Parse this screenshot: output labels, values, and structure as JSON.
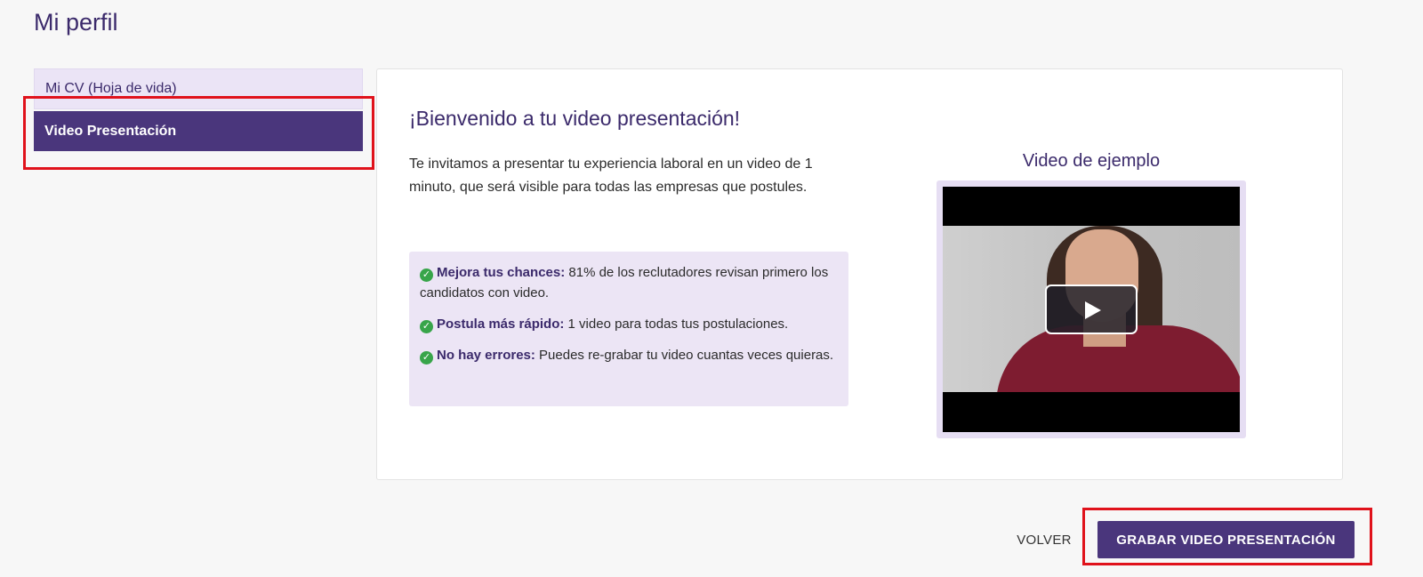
{
  "page": {
    "title": "Mi perfil"
  },
  "sidebar": {
    "items": [
      {
        "label": "Mi CV (Hoja de vida)"
      },
      {
        "label": "Video Presentación"
      }
    ]
  },
  "main": {
    "heading": "¡Bienvenido a tu video presentación!",
    "intro": "Te invitamos a presentar tu experiencia laboral en un video de 1 minuto, que será visible para todas las empresas que postules.",
    "benefits": [
      {
        "lead": "Mejora tus chances:",
        "text": " 81% de los reclutadores revisan primero los candidatos con video."
      },
      {
        "lead": "Postula más rápido:",
        "text": " 1 video para todas tus postulaciones."
      },
      {
        "lead": "No hay errores:",
        "text": " Puedes re-grabar tu video cuantas veces quieras."
      }
    ],
    "video": {
      "title": "Video de ejemplo"
    }
  },
  "footer": {
    "back_label": "VOLVER",
    "record_label": "GRABAR VIDEO PRESENTACIÓN"
  },
  "colors": {
    "accent": "#4a367c",
    "accent_light": "#ece5f5",
    "check": "#38a54a",
    "highlight": "#e0121b"
  },
  "icons": {
    "benefit_check": "check-circle-icon",
    "video_play": "play-icon"
  }
}
